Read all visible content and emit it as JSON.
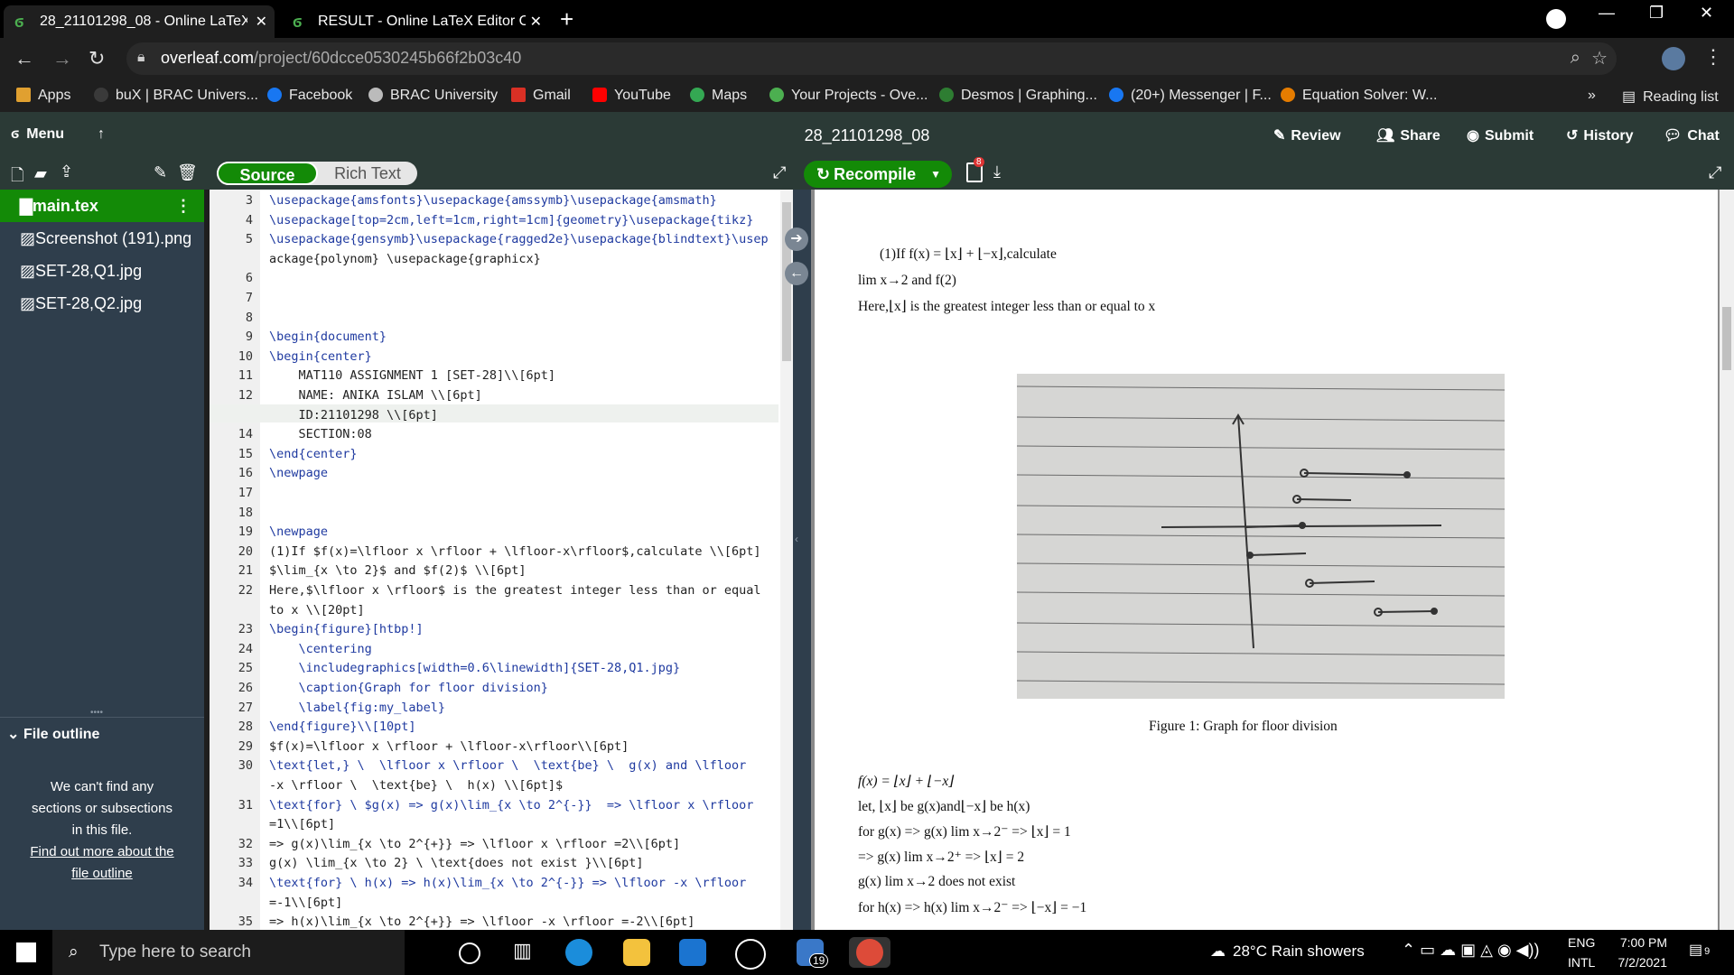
{
  "browser": {
    "tabs": [
      {
        "title": "28_21101298_08 - Online LaTeX E",
        "active": true
      },
      {
        "title": "RESULT - Online LaTeX Editor Ov",
        "active": false
      }
    ],
    "url_host": "overleaf.com",
    "url_path": "/project/60dcce0530245b66f2b03c40",
    "bookmarks": [
      "Apps",
      "buX | BRAC Univers...",
      "Facebook",
      "BRAC University",
      "Gmail",
      "YouTube",
      "Maps",
      "Your Projects - Ove...",
      "Desmos | Graphing...",
      "(20+) Messenger | F...",
      "Equation Solver: W..."
    ],
    "more": "»",
    "reading_list": "Reading list"
  },
  "header": {
    "menu": "Menu",
    "project_title": "28_21101298_08",
    "review": "Review",
    "share": "Share",
    "submit": "Submit",
    "history": "History",
    "chat": "Chat"
  },
  "toolbar": {
    "source": "Source",
    "rich_text": "Rich Text",
    "recompile": "Recompile",
    "badge": "8"
  },
  "files": [
    "main.tex",
    "Screenshot (191).png",
    "SET-28,Q1.jpg",
    "SET-28,Q2.jpg"
  ],
  "outline": {
    "title": "File outline",
    "message": "We can't find any sections or subsections in this file.",
    "link": "Find out more about the file outline"
  },
  "editor": {
    "lines": [
      {
        "n": "3",
        "t": "\\usepackage{amsfonts}\\usepackage{amssymb}\\usepackage{amsmath}"
      },
      {
        "n": "4",
        "t": "\\usepackage[top=2cm,left=1cm,right=1cm]{geometry}\\usepackage{tikz}"
      },
      {
        "n": "5",
        "t": "\\usepackage{gensymb}\\usepackage{ragged2e}\\usepackage{blindtext}\\usep"
      },
      {
        "n": "",
        "t": "ackage{polynom} \\usepackage{graphicx}"
      },
      {
        "n": "6",
        "t": ""
      },
      {
        "n": "7",
        "t": ""
      },
      {
        "n": "8",
        "t": ""
      },
      {
        "n": "9",
        "t": "\\begin{document}"
      },
      {
        "n": "10",
        "t": "\\begin{center}"
      },
      {
        "n": "11",
        "t": "    MAT110 ASSIGNMENT 1 [SET-28]\\\\[6pt]"
      },
      {
        "n": "12",
        "t": "    NAME: ANIKA ISLAM \\\\[6pt]"
      },
      {
        "n": "13",
        "t": "    ID:21101298 \\\\[6pt]"
      },
      {
        "n": "14",
        "t": "    SECTION:08"
      },
      {
        "n": "15",
        "t": "\\end{center}"
      },
      {
        "n": "16",
        "t": "\\newpage"
      },
      {
        "n": "17",
        "t": ""
      },
      {
        "n": "18",
        "t": ""
      },
      {
        "n": "19",
        "t": "\\newpage"
      },
      {
        "n": "20",
        "t": "(1)If $f(x)=\\lfloor x \\rfloor + \\lfloor-x\\rfloor$,calculate \\\\[6pt]"
      },
      {
        "n": "21",
        "t": "$\\lim_{x \\to 2}$ and $f(2)$ \\\\[6pt]"
      },
      {
        "n": "22",
        "t": "Here,$\\lfloor x \\rfloor$ is the greatest integer less than or equal"
      },
      {
        "n": "",
        "t": "to x \\\\[20pt]"
      },
      {
        "n": "23",
        "t": "\\begin{figure}[htbp!]"
      },
      {
        "n": "24",
        "t": "    \\centering"
      },
      {
        "n": "25",
        "t": "    \\includegraphics[width=0.6\\linewidth]{SET-28,Q1.jpg}"
      },
      {
        "n": "26",
        "t": "    \\caption{Graph for floor division}"
      },
      {
        "n": "27",
        "t": "    \\label{fig:my_label}"
      },
      {
        "n": "28",
        "t": "\\end{figure}\\\\[10pt]"
      },
      {
        "n": "29",
        "t": "$f(x)=\\lfloor x \\rfloor + \\lfloor-x\\rfloor\\\\[6pt]"
      },
      {
        "n": "30",
        "t": "\\text{let,} \\  \\lfloor x \\rfloor \\  \\text{be} \\  g(x) and \\lfloor"
      },
      {
        "n": "",
        "t": "-x \\rfloor \\  \\text{be} \\  h(x) \\\\[6pt]$"
      },
      {
        "n": "31",
        "t": "\\text{for} \\ $g(x) => g(x)\\lim_{x \\to 2^{-}}  => \\lfloor x \\rfloor"
      },
      {
        "n": "",
        "t": "=1\\\\[6pt]"
      },
      {
        "n": "32",
        "t": "=> g(x)\\lim_{x \\to 2^{+}} => \\lfloor x \\rfloor =2\\\\[6pt]"
      },
      {
        "n": "33",
        "t": "g(x) \\lim_{x \\to 2} \\ \\text{does not exist }\\\\[6pt]"
      },
      {
        "n": "34",
        "t": "\\text{for} \\ h(x) => h(x)\\lim_{x \\to 2^{-}} => \\lfloor -x \\rfloor"
      },
      {
        "n": "",
        "t": "=-1\\\\[6pt]"
      },
      {
        "n": "35",
        "t": "=> h(x)\\lim_{x \\to 2^{+}} => \\lfloor -x \\rfloor =-2\\\\[6pt]"
      }
    ]
  },
  "pdf": {
    "line1": "(1)If f(x) = ⌊x⌋ + ⌊−x⌋,calculate",
    "line2": "lim x→2 and f(2)",
    "line3": "Here,⌊x⌋ is the greatest integer less than or equal to x",
    "caption": "Figure 1: Graph for floor division",
    "eq1": "f(x) = ⌊x⌋ + ⌊−x⌋",
    "eq2": "let, ⌊x⌋ be g(x)and⌊−x⌋ be h(x)",
    "eq3": "for  g(x) => g(x) lim x→2⁻  => ⌊x⌋ = 1",
    "eq4": "=> g(x) lim x→2⁺ => ⌊x⌋ = 2",
    "eq5": "g(x) lim x→2  does not exist",
    "eq6": "for h(x) => h(x) lim x→2⁻ => ⌊−x⌋ = −1"
  },
  "taskbar": {
    "search_placeholder": "Type here to search",
    "badge": "19",
    "weather": "28°C  Rain showers",
    "lang1": "ENG",
    "lang2": "INTL",
    "time": "7:00 PM",
    "date": "7/2/2021",
    "notifications": "9"
  },
  "colors": {
    "accent": "#138a07",
    "sidebar": "#2f3e4c",
    "header": "#2b3a36"
  }
}
